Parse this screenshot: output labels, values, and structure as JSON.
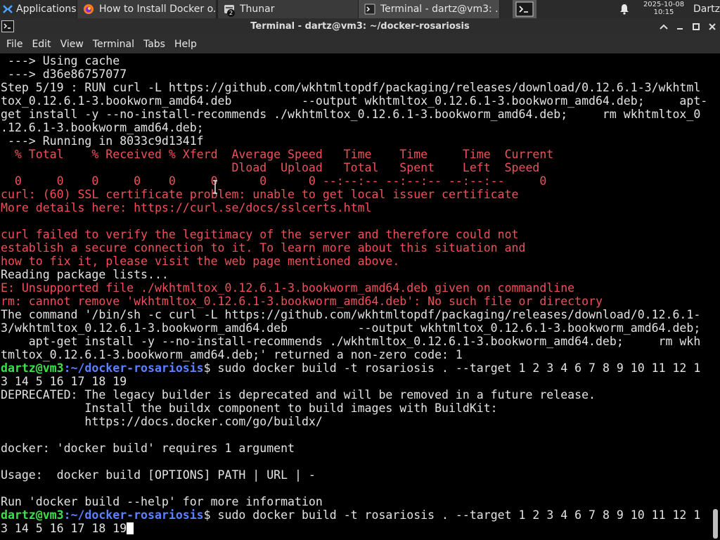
{
  "panel": {
    "applications_label": "Applications",
    "tasks": [
      {
        "label": "How to Install Docker o..."
      },
      {
        "label": "Thunar",
        "badge": "2"
      },
      {
        "label": "Terminal - dartz@vm3: ..."
      }
    ],
    "clock_date": "2025-10-08",
    "clock_time": "10:15",
    "user_label": "Dartz"
  },
  "window": {
    "title": "Terminal - dartz@vm3: ~/docker-rosariosis"
  },
  "menu": [
    "File",
    "Edit",
    "View",
    "Terminal",
    "Tabs",
    "Help"
  ],
  "colors": {
    "normal": "#e3e3e3",
    "error": "#f0505a",
    "prompt_user": "#3ce04a",
    "prompt_path": "#5c80ff",
    "background": "#000000"
  },
  "terminal": {
    "lines": [
      {
        "t": " ---> Using cache"
      },
      {
        "t": " ---> d36e86757077"
      },
      {
        "t": "Step 5/19 : RUN curl -L https://github.com/wkhtmltopdf/packaging/releases/download/0.12.6.1-3/wkhtml"
      },
      {
        "t": "tox_0.12.6.1-3.bookworm_amd64.deb          --output wkhtmltox_0.12.6.1-3.bookworm_amd64.deb;     apt-"
      },
      {
        "t": "get install -y --no-install-recommends ./wkhtmltox_0.12.6.1-3.bookworm_amd64.deb;     rm wkhtmltox_0"
      },
      {
        "t": ".12.6.1-3.bookworm_amd64.deb;"
      },
      {
        "t": " ---> Running in 8033c9d1341f"
      },
      {
        "t": "  % Total    % Received % Xferd  Average Speed   Time    Time     Time  Current",
        "c": "red"
      },
      {
        "t": "                                 Dload  Upload   Total   Spent    Left  Speed",
        "c": "red"
      },
      {
        "t": "  0     0    0     0    0     0      0      0 --:--:-- --:--:-- --:--:--     0",
        "c": "red"
      },
      {
        "t": "curl: (60) SSL certificate problem: unable to get local issuer certificate",
        "c": "red"
      },
      {
        "t": "More details here: https://curl.se/docs/sslcerts.html",
        "c": "red"
      },
      {
        "t": ""
      },
      {
        "t": "curl failed to verify the legitimacy of the server and therefore could not",
        "c": "red"
      },
      {
        "t": "establish a secure connection to it. To learn more about this situation and",
        "c": "red"
      },
      {
        "t": "how to fix it, please visit the web page mentioned above.",
        "c": "red"
      },
      {
        "t": "Reading package lists..."
      },
      {
        "t": "E: Unsupported file ./wkhtmltox_0.12.6.1-3.bookworm_amd64.deb given on commandline",
        "c": "red"
      },
      {
        "t": "rm: cannot remove 'wkhtmltox_0.12.6.1-3.bookworm_amd64.deb': No such file or directory",
        "c": "red"
      },
      {
        "t": "The command '/bin/sh -c curl -L https://github.com/wkhtmltopdf/packaging/releases/download/0.12.6.1-"
      },
      {
        "t": "3/wkhtmltox_0.12.6.1-3.bookworm_amd64.deb          --output wkhtmltox_0.12.6.1-3.bookworm_amd64.deb;"
      },
      {
        "t": "    apt-get install -y --no-install-recommends ./wkhtmltox_0.12.6.1-3.bookworm_amd64.deb;     rm wkh"
      },
      {
        "t": "tmltox_0.12.6.1-3.bookworm_amd64.deb;' returned a non-zero code: 1"
      },
      {
        "p": true,
        "user": "dartz@vm3",
        "path": ":~/docker-rosariosis",
        "t": "$ sudo docker build -t rosariosis . --target 1 2 3 4 6 7 8 9 10 11 12 1"
      },
      {
        "t": "3 14 5 16 17 18 19"
      },
      {
        "t": "DEPRECATED: The legacy builder is deprecated and will be removed in a future release."
      },
      {
        "t": "            Install the buildx component to build images with BuildKit:"
      },
      {
        "t": "            https://docs.docker.com/go/buildx/"
      },
      {
        "t": ""
      },
      {
        "t": "docker: 'docker build' requires 1 argument"
      },
      {
        "t": ""
      },
      {
        "t": "Usage:  docker build [OPTIONS] PATH | URL | -"
      },
      {
        "t": ""
      },
      {
        "t": "Run 'docker build --help' for more information"
      },
      {
        "p": true,
        "user": "dartz@vm3",
        "path": ":~/docker-rosariosis",
        "t": "$ sudo docker build -t rosariosis . --target 1 2 3 4 6 7 8 9 10 11 12 1"
      },
      {
        "t": "3 14 5 16 17 18 19",
        "cursor": true
      }
    ]
  }
}
